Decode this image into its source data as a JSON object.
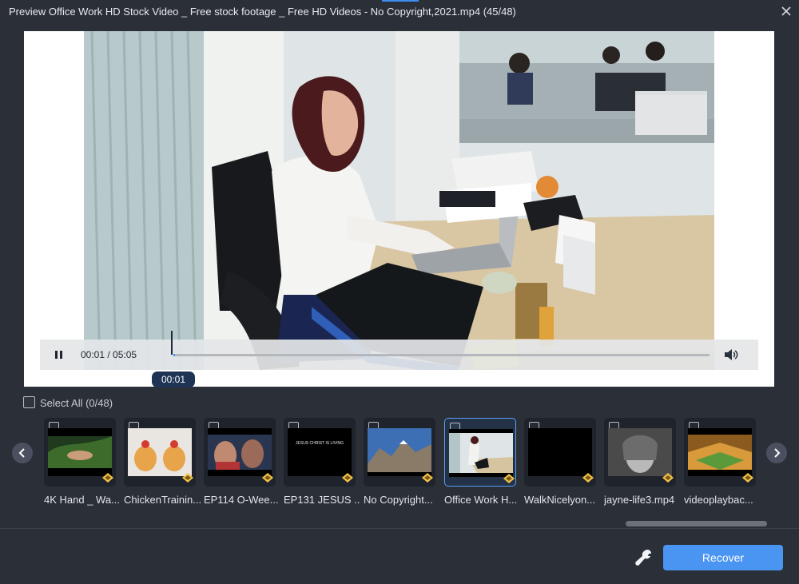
{
  "window": {
    "title": "Preview Office Work HD Stock Video _ Free stock footage _ Free HD Videos - No Copyright,2021.mp4 (45/48)"
  },
  "player": {
    "time_display": "00:01 / 05:05",
    "tooltip_time": "00:01",
    "progress_fraction": 0.003
  },
  "selection": {
    "select_all_label": "Select All (0/48)"
  },
  "thumbnails": [
    {
      "label": "4K Hand _ Wa...",
      "icon": "thumb-hand-nature"
    },
    {
      "label": "ChickenTrainin...",
      "icon": "thumb-chicken"
    },
    {
      "label": "EP114 O-Wee...",
      "icon": "thumb-news-nick"
    },
    {
      "label": "EP131 JESUS ...",
      "icon": "thumb-black-text",
      "caption": "JESUS CHRIST IS LIVING"
    },
    {
      "label": "No Copyright...",
      "icon": "thumb-mountains"
    },
    {
      "label": "Office Work H...",
      "icon": "thumb-office"
    },
    {
      "label": "WalkNicelyon...",
      "icon": "thumb-black"
    },
    {
      "label": "jayne-life3.mp4",
      "icon": "thumb-portrait-bw"
    },
    {
      "label": "videoplaybac...",
      "icon": "thumb-game"
    }
  ],
  "footer": {
    "recover_label": "Recover"
  },
  "colors": {
    "accent": "#4a95f2",
    "background": "#2b2f38"
  }
}
